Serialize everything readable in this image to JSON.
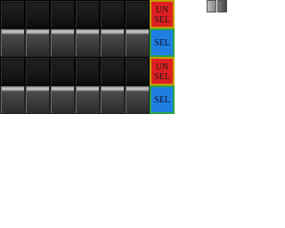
{
  "rows": [
    {
      "style": "dark",
      "tag": "unselected",
      "tag_lines": [
        "UN",
        "SEL"
      ]
    },
    {
      "style": "light",
      "tag": "selected",
      "tag_lines": [
        "SEL"
      ]
    },
    {
      "style": "dark",
      "tag": "unselected",
      "tag_lines": [
        "UN",
        "SEL"
      ]
    },
    {
      "style": "light",
      "tag": "selected",
      "tag_lines": [
        "SEL"
      ]
    }
  ],
  "tiles_per_row": 6,
  "colors": {
    "unselected_tag": "#e02020",
    "selected_tag": "#1e7fe0",
    "unselected_border": "#c8a000",
    "selected_border": "#2aa54a"
  },
  "swatches": [
    "light-gray",
    "dark-gray"
  ]
}
